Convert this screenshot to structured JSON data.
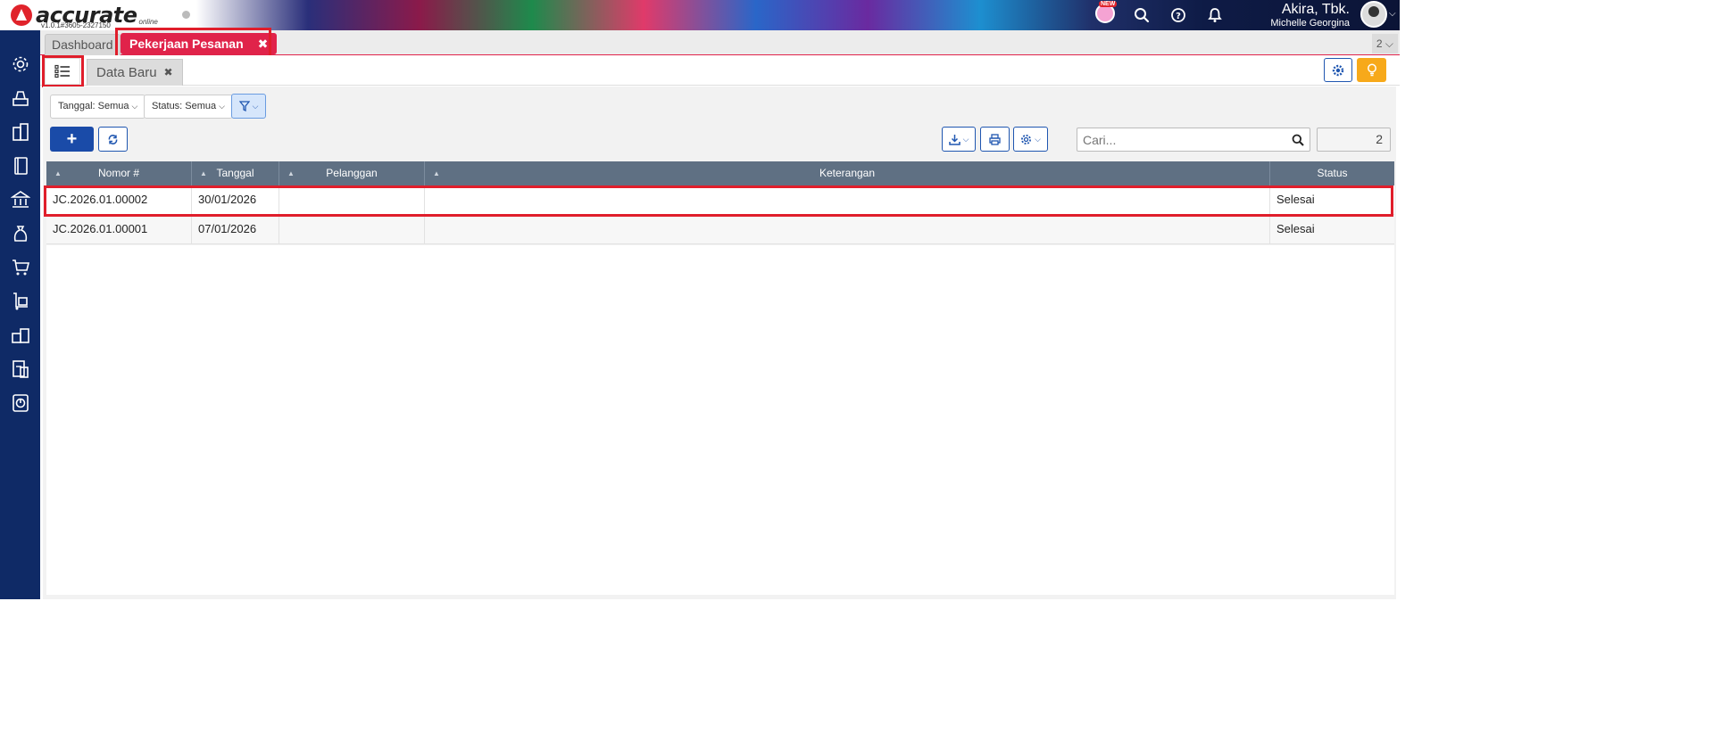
{
  "app": {
    "name": "accurate",
    "cloud_label": "online",
    "version": "v1.0.1#3605-2327150",
    "company": "Akira, Tbk.",
    "user_name": "Michelle Georgina",
    "new_badge": "NEW"
  },
  "module_tabs": {
    "dashboard": "Dashboard",
    "active": "Pekerjaan Pesanan",
    "close_glyph": "✖",
    "open_count": "2"
  },
  "sub_tabs": {
    "data_baru": "Data Baru",
    "close_glyph": "✖"
  },
  "filters": {
    "tanggal": "Tanggal: Semua",
    "status": "Status: Semua"
  },
  "toolbar": {
    "add_glyph": "+",
    "search_placeholder": "Cari...",
    "record_count": "2"
  },
  "table": {
    "columns": [
      "Nomor #",
      "Tanggal",
      "Pelanggan",
      "Keterangan",
      "Status"
    ],
    "rows": [
      [
        "JC.2026.01.00002",
        "30/01/2026",
        "",
        "",
        "Selesai"
      ],
      [
        "JC.2026.01.00001",
        "07/01/2026",
        "",
        "",
        "Selesai"
      ]
    ]
  },
  "colors": {
    "accent_red": "#e0234a",
    "nav_blue": "#0f2a66",
    "primary_blue": "#1a4ba8",
    "header_gray": "#5f7083",
    "warning_orange": "#f7a91a"
  }
}
